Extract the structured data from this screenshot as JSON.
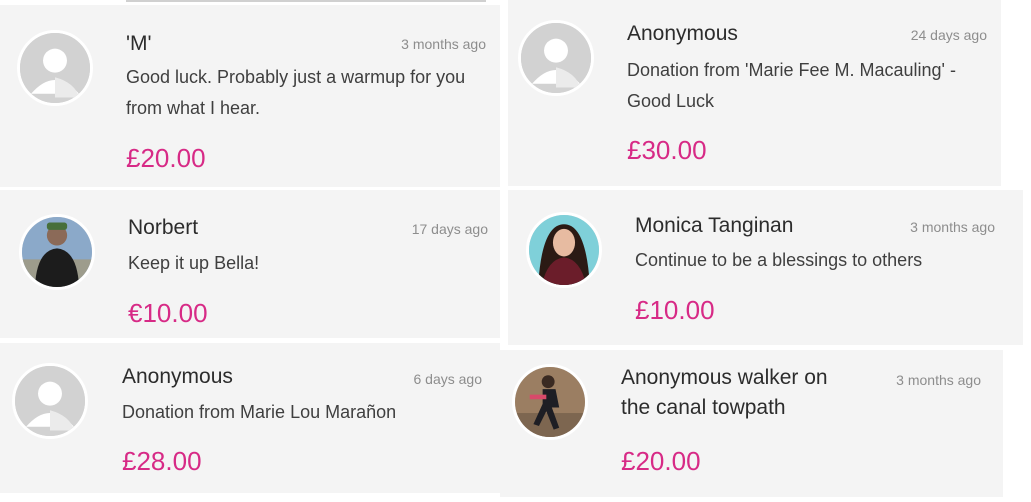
{
  "donations": [
    {
      "name": "'M'",
      "time": "3 months ago",
      "message": "Good luck. Probably just a warmup for you from what I hear.",
      "amount": "£20.00",
      "avatar": "default-avatar-icon"
    },
    {
      "name": "Anonymous",
      "time": "24 days ago",
      "message": "Donation from 'Marie Fee M. Macauling' - Good Luck",
      "amount": "£30.00",
      "avatar": "default-avatar-icon"
    },
    {
      "name": "Norbert",
      "time": "17 days ago",
      "message": "Keep it up Bella!",
      "amount": "€10.00",
      "avatar": "profile-photo"
    },
    {
      "name": "Monica Tanginan",
      "time": "3 months ago",
      "message": "Continue to be a blessings to others",
      "amount": "£10.00",
      "avatar": "profile-photo"
    },
    {
      "name": "Anonymous",
      "time": "6 days ago",
      "message": "Donation from Marie Lou Marañon",
      "amount": "£28.00",
      "avatar": "default-avatar-icon"
    },
    {
      "name": "Anonymous walker on the canal towpath",
      "time": "3 months ago",
      "message": "",
      "amount": "£20.00",
      "avatar": "profile-photo"
    }
  ],
  "colors": {
    "card_bg": "#f4f4f4",
    "amount": "#d72a86",
    "name": "#2c2c2c",
    "message": "#3f3f3f",
    "time": "#8d8d8d"
  }
}
